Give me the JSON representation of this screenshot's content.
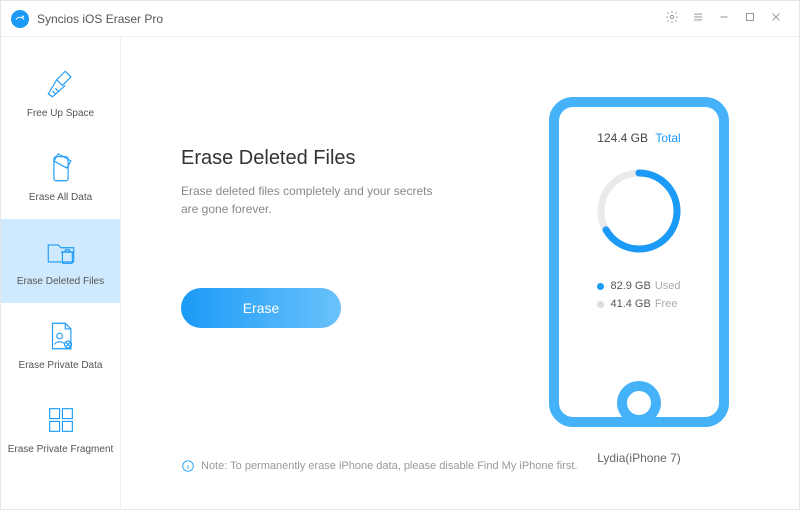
{
  "app_title": "Syncios iOS Eraser Pro",
  "sidebar": {
    "items": [
      {
        "label": "Free Up Space"
      },
      {
        "label": "Erase All Data"
      },
      {
        "label": "Erase Deleted Files"
      },
      {
        "label": "Erase Private Data"
      },
      {
        "label": "Erase Private Fragment"
      }
    ]
  },
  "main": {
    "heading": "Erase Deleted Files",
    "subtext": "Erase deleted files completely and your secrets are gone forever.",
    "erase_button": "Erase",
    "note": "Note: To permanently erase iPhone data, please disable Find My iPhone first."
  },
  "device": {
    "total_value": "124.4 GB",
    "total_label": "Total",
    "used_value": "82.9 GB",
    "used_label": "Used",
    "free_value": "41.4 GB",
    "free_label": "Free",
    "name": "Lydia(iPhone 7)"
  },
  "chart_data": {
    "type": "pie",
    "title": "Storage",
    "series": [
      {
        "name": "Used",
        "value": 82.9,
        "color": "#1b9af7"
      },
      {
        "name": "Free",
        "value": 41.4,
        "color": "#e6e6e6"
      }
    ],
    "total": 124.4,
    "unit": "GB"
  }
}
